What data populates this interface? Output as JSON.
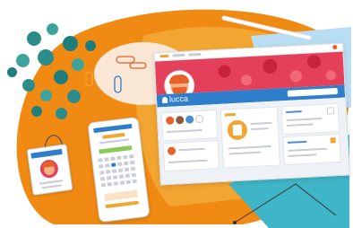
{
  "app": {
    "brand_name": "lucca",
    "colors": {
      "banner": "#e4405a",
      "brand_bar": "#2f7ecb",
      "accent_orange": "#f3a531",
      "background_blob": "#f08a12"
    }
  },
  "icons": {
    "brand": "map-pin-icon",
    "avatar": "avatar-illustration"
  }
}
